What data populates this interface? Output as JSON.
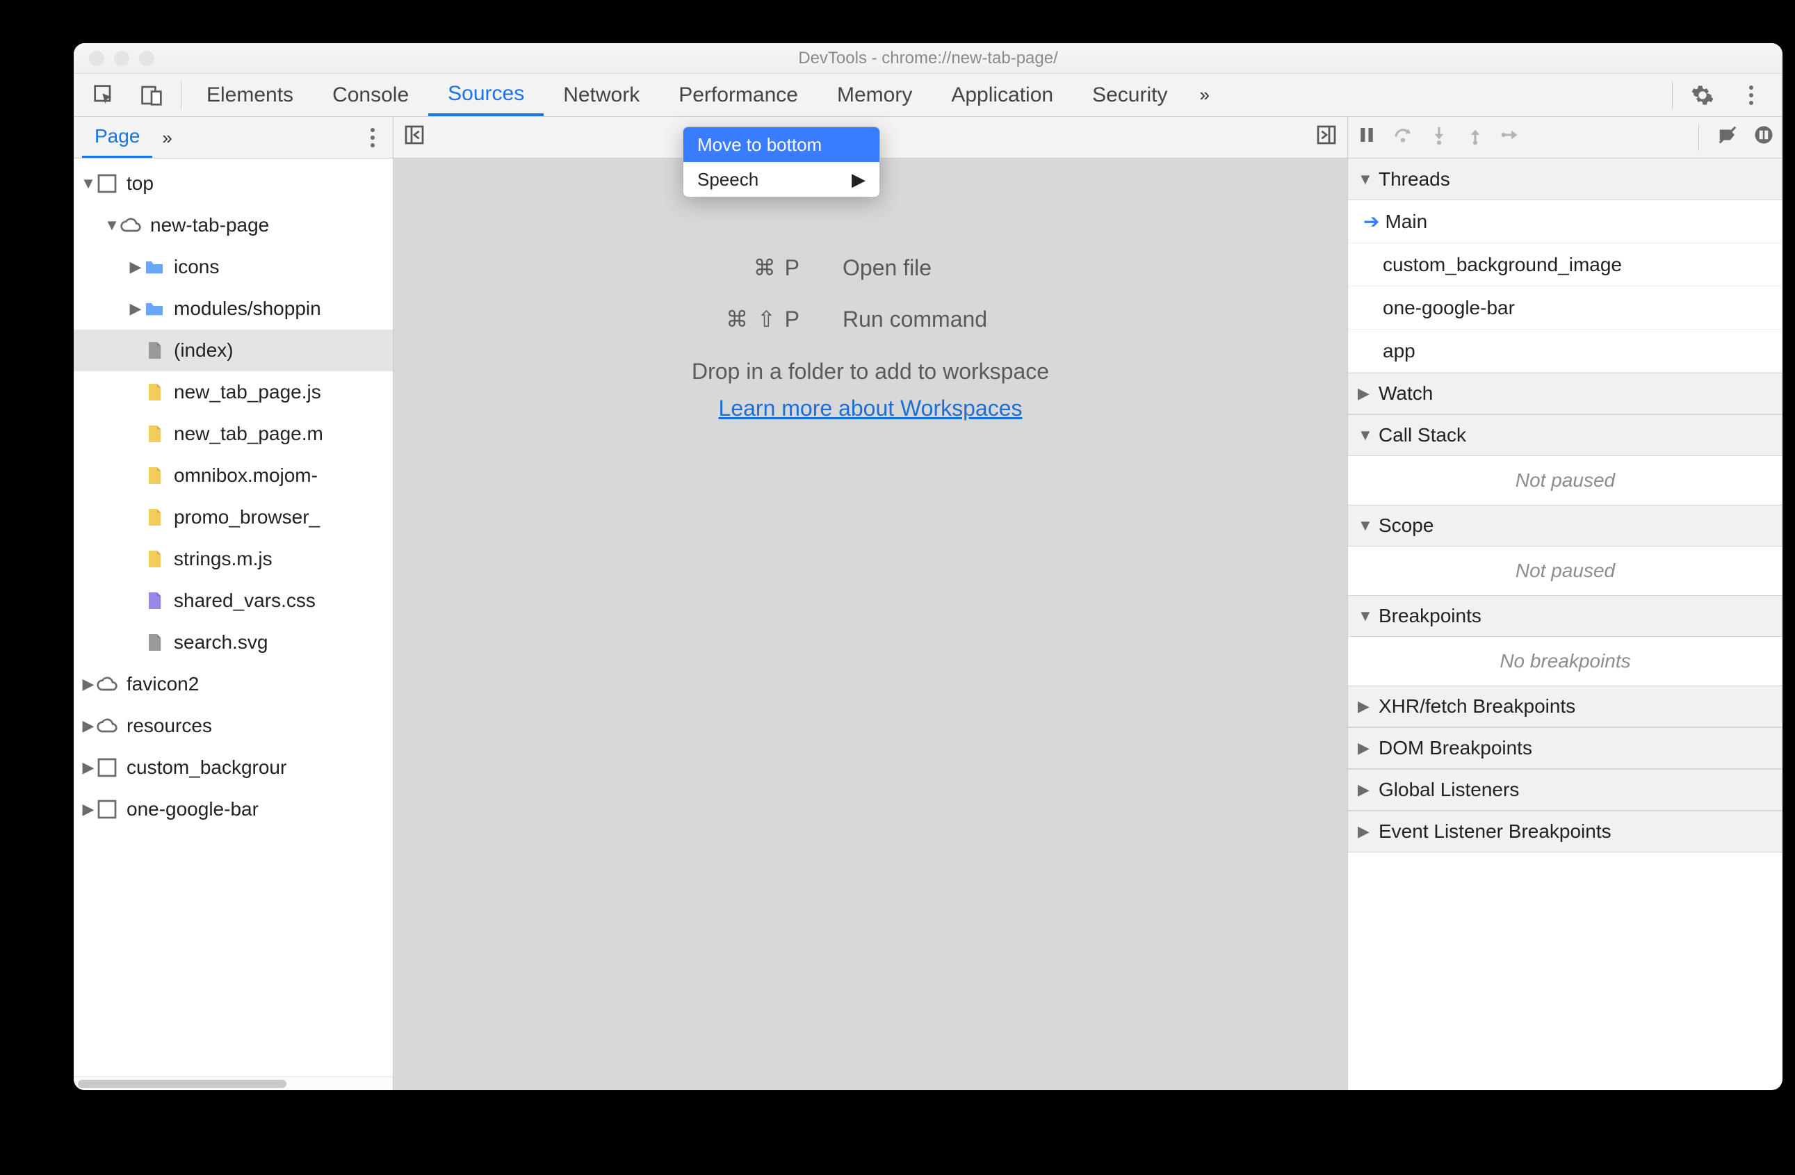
{
  "window": {
    "title": "DevTools - chrome://new-tab-page/"
  },
  "mainTabs": [
    "Elements",
    "Console",
    "Sources",
    "Network",
    "Performance",
    "Memory",
    "Application",
    "Security"
  ],
  "activeTab": "Sources",
  "leftPane": {
    "tab": "Page",
    "tree": {
      "top": "top",
      "domain": "new-tab-page",
      "folders": [
        "icons",
        "modules/shoppin"
      ],
      "indexFile": "(index)",
      "files": [
        {
          "name": "new_tab_page.js",
          "kind": "js"
        },
        {
          "name": "new_tab_page.m",
          "kind": "js"
        },
        {
          "name": "omnibox.mojom-",
          "kind": "js"
        },
        {
          "name": "promo_browser_",
          "kind": "js"
        },
        {
          "name": "strings.m.js",
          "kind": "js"
        },
        {
          "name": "shared_vars.css",
          "kind": "css"
        },
        {
          "name": "search.svg",
          "kind": "svg"
        }
      ],
      "otherDomains": [
        {
          "name": "favicon2",
          "kind": "cloud"
        },
        {
          "name": "resources",
          "kind": "cloud"
        },
        {
          "name": "custom_backgrour",
          "kind": "frame"
        },
        {
          "name": "one-google-bar",
          "kind": "frame"
        }
      ]
    }
  },
  "centerPlaceholder": {
    "openKey": "⌘ P",
    "openLabel": "Open file",
    "runKey": "⌘ ⇧ P",
    "runLabel": "Run command",
    "dropLine": "Drop in a folder to add to workspace",
    "link": "Learn more about Workspaces"
  },
  "contextMenu": {
    "items": [
      {
        "label": "Move to bottom",
        "hl": true
      },
      {
        "label": "Speech",
        "sub": true
      }
    ]
  },
  "rightPane": {
    "sections": [
      {
        "title": "Threads",
        "open": true,
        "items": [
          "Main",
          "custom_background_image",
          "one-google-bar",
          "app"
        ],
        "activeIndex": 0
      },
      {
        "title": "Watch",
        "open": false
      },
      {
        "title": "Call Stack",
        "open": true,
        "message": "Not paused"
      },
      {
        "title": "Scope",
        "open": true,
        "message": "Not paused"
      },
      {
        "title": "Breakpoints",
        "open": true,
        "message": "No breakpoints"
      },
      {
        "title": "XHR/fetch Breakpoints",
        "open": false
      },
      {
        "title": "DOM Breakpoints",
        "open": false
      },
      {
        "title": "Global Listeners",
        "open": false
      },
      {
        "title": "Event Listener Breakpoints",
        "open": false
      }
    ]
  },
  "glyphs": {
    "more": "»",
    "arrowDown": "▼",
    "arrowRight": "▶",
    "subArrow": "▶"
  }
}
